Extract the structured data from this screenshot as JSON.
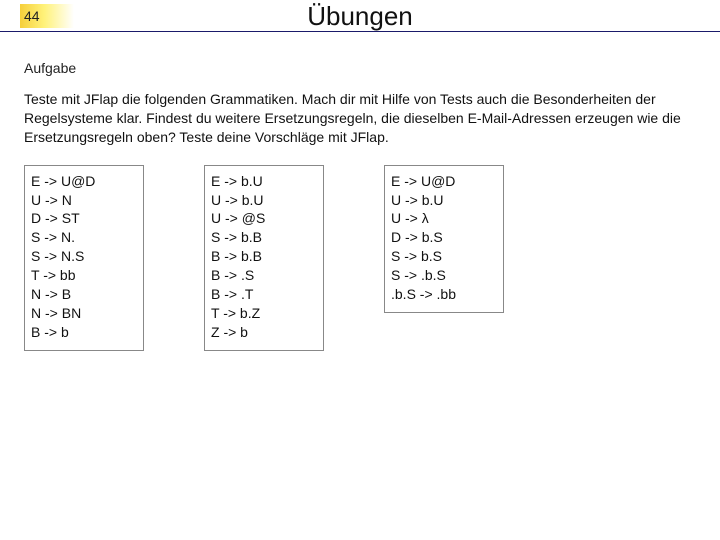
{
  "header": {
    "page_number": "44",
    "title": "Übungen"
  },
  "section_heading": "Aufgabe",
  "task_text": "Teste mit JFlap die folgenden Grammatiken. Mach dir mit Hilfe von Tests auch die Besonderheiten der Regelsysteme klar. Findest du weitere Ersetzungsregeln, die dieselben E-Mail-Adressen erzeugen wie die Ersetzungsregeln oben? Teste deine Vorschläge mit JFlap.",
  "grammars": [
    {
      "rules": [
        "E -> U@D",
        "U -> N",
        "D -> ST",
        "S -> N.",
        "S -> N.S",
        "T -> bb",
        "N -> B",
        "N -> BN",
        "B -> b"
      ]
    },
    {
      "rules": [
        "E -> b.U",
        "U -> b.U",
        "U -> @S",
        "S -> b.B",
        "B -> b.B",
        "B -> .S",
        "B -> .T",
        "T -> b.Z",
        "Z -> b"
      ]
    },
    {
      "rules": [
        "E -> U@D",
        "U -> b.U",
        "U -> λ",
        "D -> b.S",
        "S -> b.S",
        "S -> .b.S",
        ".b.S -> .bb"
      ]
    }
  ]
}
